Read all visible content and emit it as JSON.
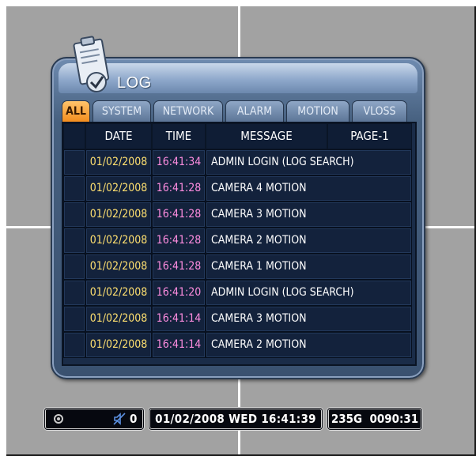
{
  "window": {
    "title": "LOG"
  },
  "tabs": [
    {
      "label": "ALL",
      "active": true
    },
    {
      "label": "SYSTEM",
      "active": false
    },
    {
      "label": "NETWORK",
      "active": false
    },
    {
      "label": "ALARM",
      "active": false
    },
    {
      "label": "MOTION",
      "active": false
    },
    {
      "label": "VLOSS",
      "active": false
    }
  ],
  "table": {
    "headers": {
      "date": "DATE",
      "time": "TIME",
      "message": "MESSAGE",
      "page": "PAGE-1"
    },
    "rows": [
      {
        "date": "01/02/2008",
        "time": "16:41:34",
        "message": "ADMIN LOGIN (LOG SEARCH)"
      },
      {
        "date": "01/02/2008",
        "time": "16:41:28",
        "message": "CAMERA 4 MOTION"
      },
      {
        "date": "01/02/2008",
        "time": "16:41:28",
        "message": "CAMERA 3 MOTION"
      },
      {
        "date": "01/02/2008",
        "time": "16:41:28",
        "message": "CAMERA 2 MOTION"
      },
      {
        "date": "01/02/2008",
        "time": "16:41:28",
        "message": "CAMERA 1 MOTION"
      },
      {
        "date": "01/02/2008",
        "time": "16:41:20",
        "message": "ADMIN LOGIN (LOG SEARCH)"
      },
      {
        "date": "01/02/2008",
        "time": "16:41:14",
        "message": "CAMERA 3 MOTION"
      },
      {
        "date": "01/02/2008",
        "time": "16:41:14",
        "message": "CAMERA 2 MOTION"
      }
    ]
  },
  "status_bar": {
    "record_icon": "record-icon",
    "audio_icon": "audio-muted-icon",
    "audio_count": "0",
    "datetime": "01/02/2008 WED 16:41:39",
    "hdd": "235G  0090:31"
  },
  "colors": {
    "active_tab": "#f59a2a",
    "date_text": "#ffe070",
    "time_text": "#ff8de0",
    "panel": "#46607f",
    "table_bg": "#13223c"
  }
}
